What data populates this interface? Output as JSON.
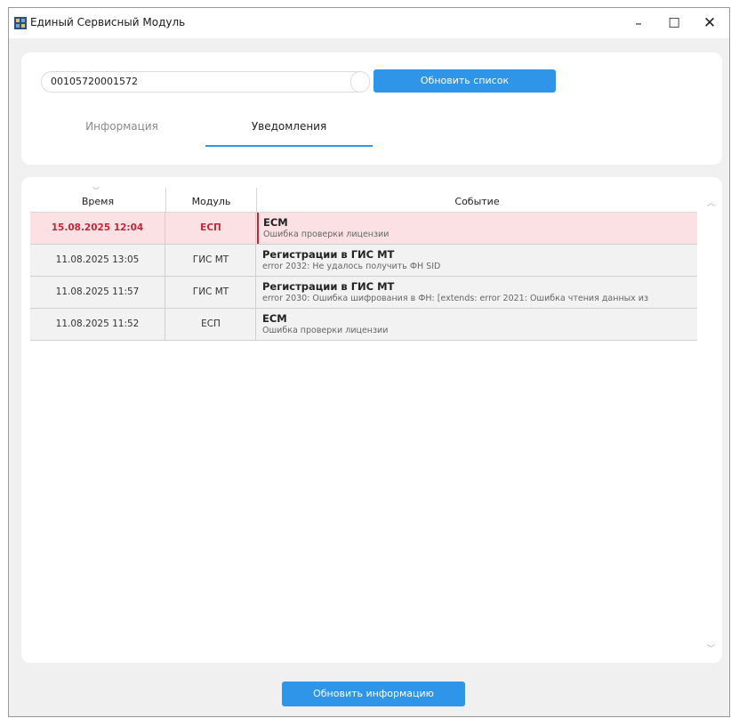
{
  "window": {
    "title": "Единый Сервисный Модуль",
    "controls": {
      "minimize": "–",
      "maximize": "☐",
      "close": "✕"
    }
  },
  "search": {
    "value": "00105720001572"
  },
  "buttons": {
    "refresh_list": "Обновить список",
    "refresh_info": "Обновить информацию"
  },
  "tabs": [
    {
      "label": "Информация",
      "active": false
    },
    {
      "label": "Уведомления",
      "active": true
    }
  ],
  "table": {
    "headers": {
      "time": "Время",
      "module": "Модуль",
      "event": "Событие"
    },
    "rows": [
      {
        "time": "15.08.2025 12:04",
        "module": "ЕСП",
        "title": "ЕСМ",
        "desc": "Ошибка проверки лицензии",
        "highlighted": true
      },
      {
        "time": "11.08.2025 13:05",
        "module": "ГИС МТ",
        "title": "Регистрации в ГИС МТ",
        "desc": "error 2032: Не удалось получить ФН SID",
        "highlighted": false
      },
      {
        "time": "11.08.2025 11:57",
        "module": "ГИС МТ",
        "title": "Регистрации в ГИС МТ",
        "desc": "error 2030: Ошибка шифрования в ФН: [extends: error 2021: Ошибка чтения данных из",
        "highlighted": false
      },
      {
        "time": "11.08.2025 11:52",
        "module": "ЕСП",
        "title": "ЕСМ",
        "desc": "Ошибка проверки лицензии",
        "highlighted": false
      }
    ]
  },
  "colors": {
    "accent": "#2e95e8",
    "alert": "#c0283a",
    "alert_bg": "#fbe1e3"
  }
}
